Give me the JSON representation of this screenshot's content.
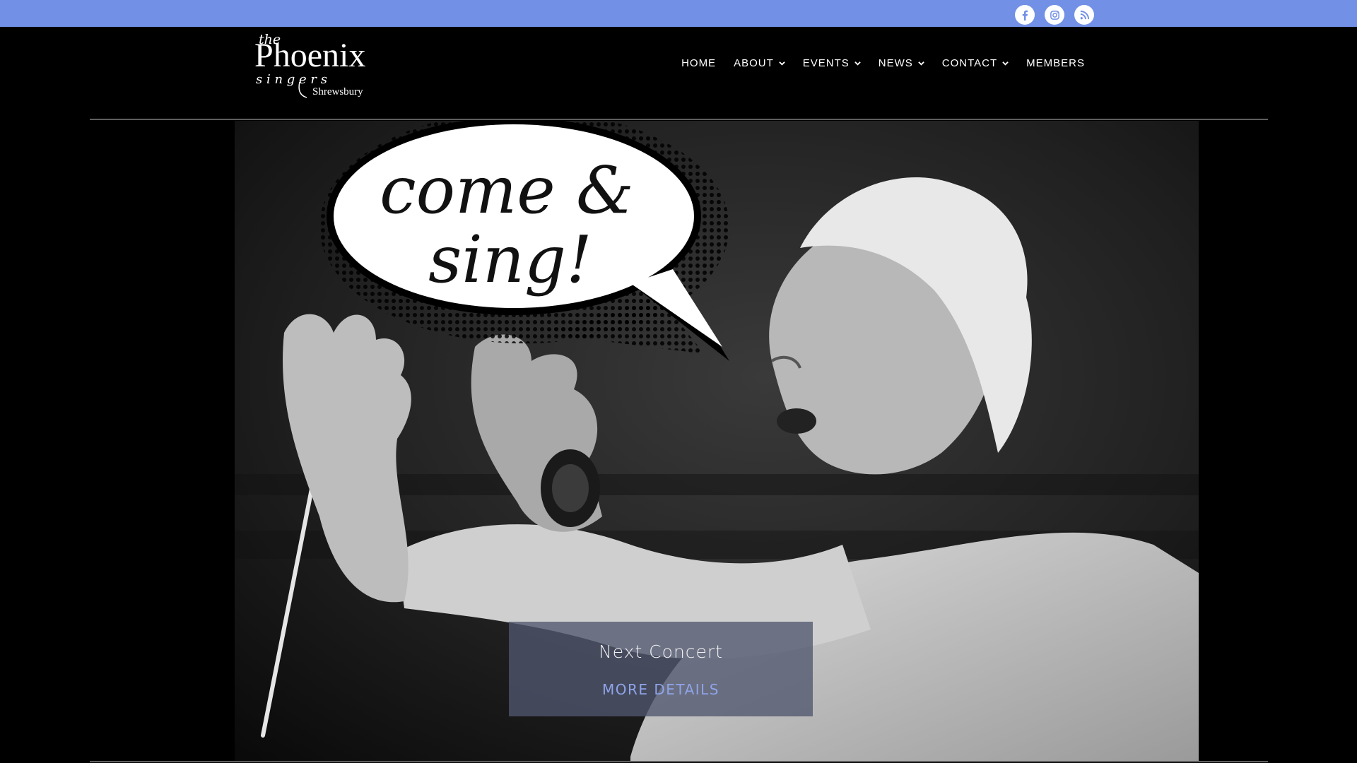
{
  "topbar": {
    "bg_color": "#7190e6",
    "social": [
      {
        "icon": "facebook-icon",
        "label": "Facebook"
      },
      {
        "icon": "instagram-icon",
        "label": "Instagram"
      },
      {
        "icon": "rss-icon",
        "label": "RSS"
      }
    ]
  },
  "logo": {
    "line1": "the",
    "line2": "Phoenix",
    "line3": "s i n g e r s",
    "line4": "Shrewsbury"
  },
  "nav": {
    "items": [
      {
        "label": "HOME",
        "dropdown": false
      },
      {
        "label": "ABOUT",
        "dropdown": true
      },
      {
        "label": "EVENTS",
        "dropdown": true
      },
      {
        "label": "NEWS",
        "dropdown": true
      },
      {
        "label": "CONTACT",
        "dropdown": true
      },
      {
        "label": "MEMBERS",
        "dropdown": false
      }
    ]
  },
  "hero": {
    "bubble_line1": "come &",
    "bubble_line2": "sing!",
    "next_concert_title": "Next Concert",
    "more_details_label": "MORE DETAILS",
    "accent_color": "#8fa4e8"
  }
}
